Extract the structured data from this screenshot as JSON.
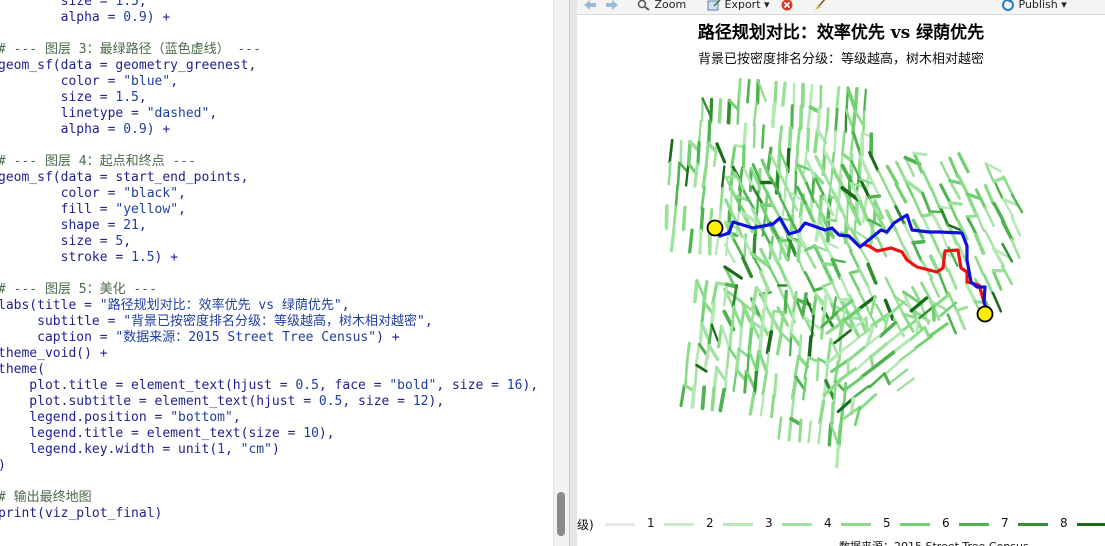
{
  "editor": {
    "lines": [
      "        size = 1.5,",
      "        alpha = 0.9) +",
      "",
      "# --- 图层 3：最绿路径（蓝色虚线） ---",
      "geom_sf(data = geometry_greenest,",
      "        color = \"blue\",",
      "        size = 1.5,",
      "        linetype = \"dashed\",",
      "        alpha = 0.9) +",
      "",
      "# --- 图层 4：起点和终点 ---",
      "geom_sf(data = start_end_points,",
      "        color = \"black\",",
      "        fill = \"yellow\",",
      "        shape = 21,",
      "        size = 5,",
      "        stroke = 1.5) +",
      "",
      "# --- 图层 5：美化 ---",
      "labs(title = \"路径规划对比：效率优先 vs 绿荫优先\",",
      "     subtitle = \"背景已按密度排名分级：等级越高，树木相对越密\",",
      "     caption = \"数据来源：2015 Street Tree Census\") +",
      "theme_void() +",
      "theme(",
      "    plot.title = element_text(hjust = 0.5, face = \"bold\", size = 16),",
      "    plot.subtitle = element_text(hjust = 0.5, size = 12),",
      "    legend.position = \"bottom\",",
      "    legend.title = element_text(size = 10),",
      "    legend.key.width = unit(1, \"cm\")",
      ")",
      "",
      "# 输出最终地图",
      "print(viz_plot_final)"
    ]
  },
  "viewer_toolbar": {
    "zoom_label": "Zoom",
    "export_label": "Export",
    "publish_label": "Publish",
    "back_icon": "arrow-left-icon",
    "forward_icon": "arrow-right-icon",
    "zoom_icon": "magnifier-icon",
    "remove_icon": "remove-plot-icon",
    "clear_icon": "broom-icon",
    "publish_icon": "publish-icon"
  },
  "plot": {
    "title": "路径规划对比：效率优先 vs 绿荫优先",
    "subtitle": "背景已按密度排名分级：等级越高，树木相对越密",
    "caption": "数据来源：2015 Street Tree Census",
    "legend_title_partial": "级)",
    "legend_levels": [
      {
        "label": "1",
        "color": "#e6ebe6"
      },
      {
        "label": "2",
        "color": "#c8ecc8"
      },
      {
        "label": "3",
        "color": "#b4e8b4"
      },
      {
        "label": "4",
        "color": "#9fe29f"
      },
      {
        "label": "5",
        "color": "#8cdc8c"
      },
      {
        "label": "6",
        "color": "#72cf72"
      },
      {
        "label": "7",
        "color": "#4fb44f"
      },
      {
        "label": "8",
        "color": "#2f8f2f"
      },
      {
        "label": "",
        "color": "#1b6b1b"
      }
    ],
    "efficient_route_color": "#ee1111",
    "greenest_route_color": "#1010dd",
    "point_fill": "#ffee00"
  }
}
